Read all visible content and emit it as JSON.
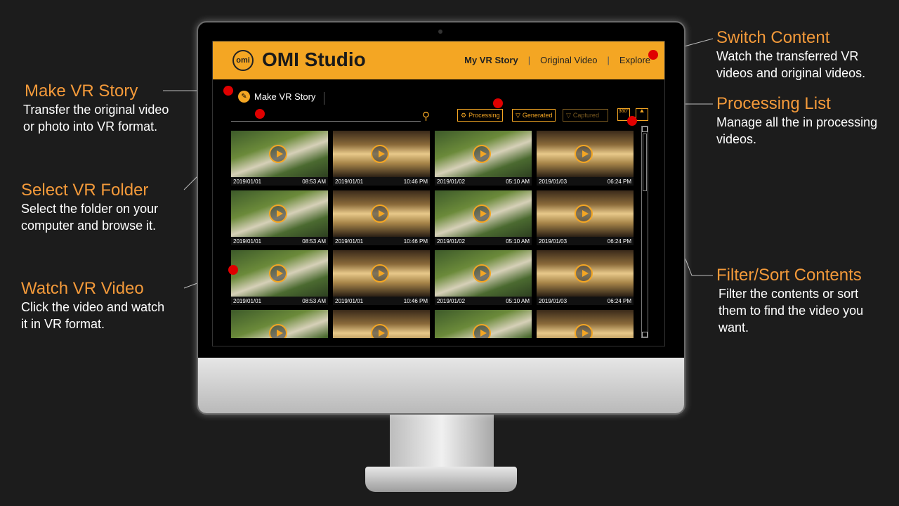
{
  "callouts": {
    "make_story": {
      "title": "Make VR Story",
      "desc1": "Transfer the original video",
      "desc2": "or photo into VR format."
    },
    "select_folder": {
      "title": "Select VR Folder",
      "desc1": "Select the folder on your",
      "desc2": "computer and browse it."
    },
    "watch_video": {
      "title": "Watch VR Video",
      "desc1": "Click the video and watch",
      "desc2": "it in VR format."
    },
    "switch_content": {
      "title": "Switch Content",
      "desc1": "Watch the transferred VR",
      "desc2": "videos and original videos."
    },
    "processing_list": {
      "title": "Processing List",
      "desc1": "Manage all the in processing",
      "desc2": "videos."
    },
    "filter_sort": {
      "title": "Filter/Sort Contents",
      "desc1": "Filter the contents or sort",
      "desc2": "them to find the video you",
      "desc3": "want."
    }
  },
  "app": {
    "logo_text": "omi",
    "brand": "OMI Studio",
    "nav": {
      "my_story": "My VR Story",
      "original": "Original Video",
      "explore": "Explore",
      "sep": "|"
    },
    "make_story_label": "Make VR Story",
    "toolbar": {
      "processing": "Processing",
      "generated": "Generated",
      "captured": "Captured",
      "btn360": "360°"
    }
  },
  "tiles": [
    {
      "date": "2019/01/01",
      "time": "08:53 AM",
      "scene": "garden"
    },
    {
      "date": "2019/01/01",
      "time": "10:46 PM",
      "scene": "cafe"
    },
    {
      "date": "2019/01/02",
      "time": "05:10 AM",
      "scene": "garden"
    },
    {
      "date": "2019/01/03",
      "time": "06:24 PM",
      "scene": "cafe"
    },
    {
      "date": "2019/01/01",
      "time": "08:53 AM",
      "scene": "garden"
    },
    {
      "date": "2019/01/01",
      "time": "10:46 PM",
      "scene": "cafe"
    },
    {
      "date": "2019/01/02",
      "time": "05:10 AM",
      "scene": "garden"
    },
    {
      "date": "2019/01/03",
      "time": "06:24 PM",
      "scene": "cafe"
    },
    {
      "date": "2019/01/01",
      "time": "08:53 AM",
      "scene": "garden"
    },
    {
      "date": "2019/01/01",
      "time": "10:46 PM",
      "scene": "cafe"
    },
    {
      "date": "2019/01/02",
      "time": "05:10 AM",
      "scene": "garden"
    },
    {
      "date": "2019/01/03",
      "time": "06:24 PM",
      "scene": "cafe"
    },
    {
      "date": "",
      "time": "",
      "scene": "garden"
    },
    {
      "date": "",
      "time": "",
      "scene": "cafe"
    },
    {
      "date": "",
      "time": "",
      "scene": "garden"
    },
    {
      "date": "",
      "time": "",
      "scene": "cafe"
    }
  ],
  "colors": {
    "accent": "#f4a623",
    "callout_title": "#f49a3a",
    "marker": "#e00000"
  }
}
